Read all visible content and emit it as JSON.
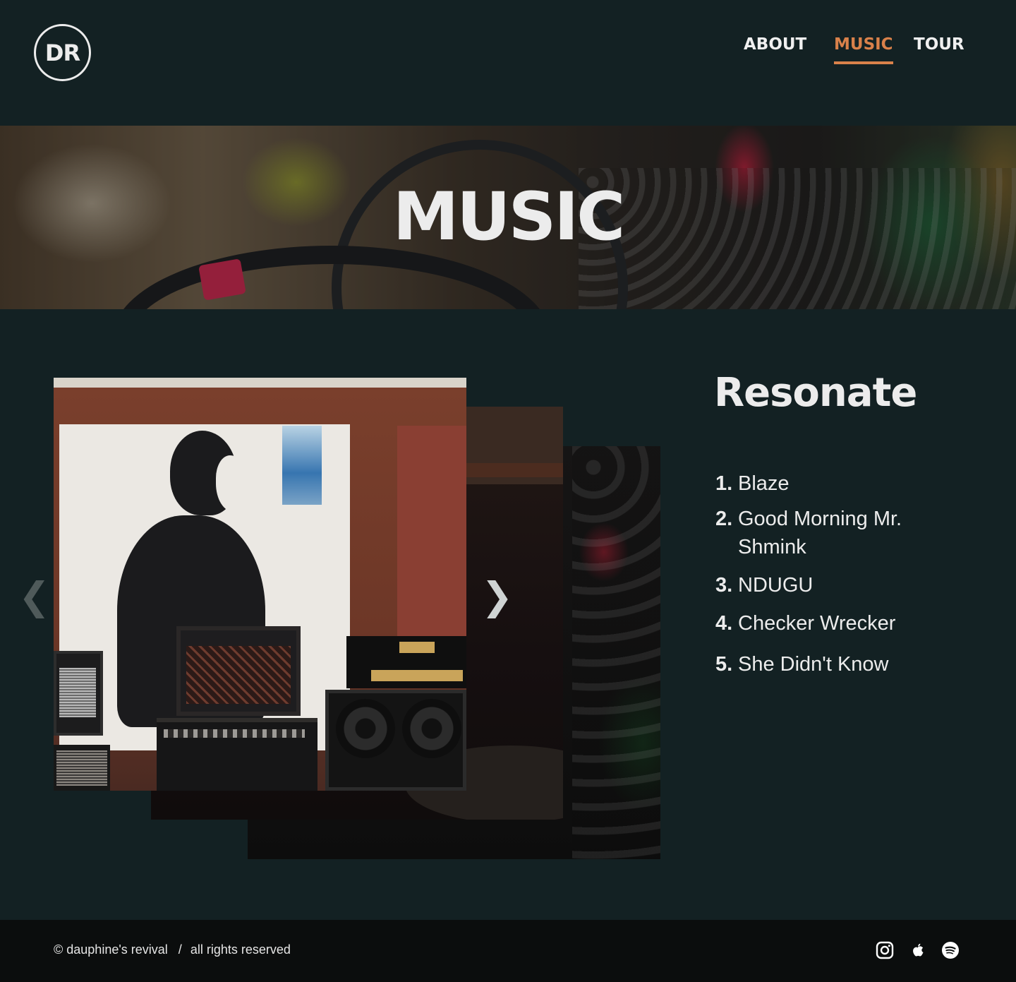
{
  "brand": {
    "logo_text": "DR"
  },
  "nav": {
    "items": [
      {
        "label": "ABOUT",
        "active": false
      },
      {
        "label": "MUSIC",
        "active": true
      },
      {
        "label": "TOUR",
        "active": false
      }
    ],
    "active_color": "#d9814a"
  },
  "hero": {
    "title": "MUSIC"
  },
  "carousel": {
    "prev_icon": "chevron-left-icon",
    "next_icon": "chevron-right-icon"
  },
  "album": {
    "title": "Resonate",
    "tracks": [
      {
        "number": "1.",
        "title": "Blaze"
      },
      {
        "number": "2.",
        "title": "Good Morning Mr. Shmink"
      },
      {
        "number": "3.",
        "title": "NDUGU"
      },
      {
        "number": "4.",
        "title": "Checker Wrecker"
      },
      {
        "number": "5.",
        "title": "She Didn't Know"
      }
    ]
  },
  "footer": {
    "copyright": "© dauphine's revival",
    "separator": "/",
    "rights": "all rights reserved",
    "social": [
      "instagram-icon",
      "apple-icon",
      "spotify-icon"
    ]
  },
  "colors": {
    "background": "#132123",
    "footer": "#0b0d0d",
    "accent": "#d9814a"
  }
}
